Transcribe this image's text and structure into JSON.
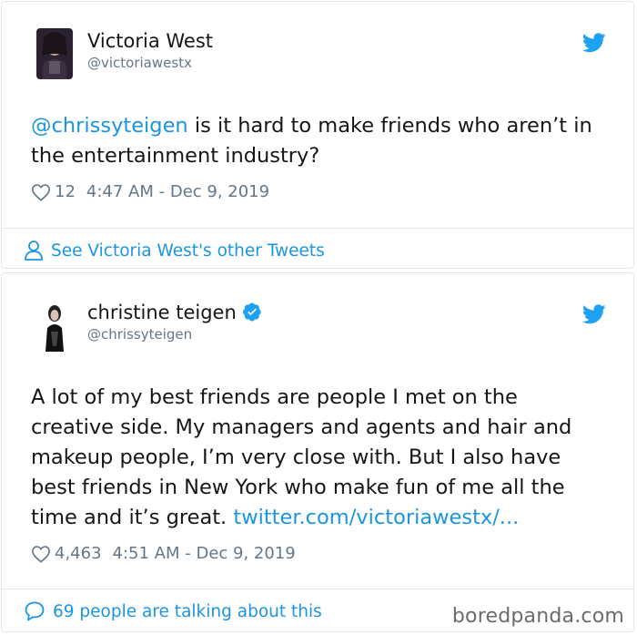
{
  "tweet1": {
    "name": "Victoria West",
    "handle": "@victoriawestx",
    "mention": "@chrissyteigen",
    "text": " is it hard to make friends who aren’t in the entertainment industry?",
    "likes": "12",
    "timestamp": "4:47 AM - Dec 9, 2019",
    "footer_link": "See Victoria West's other Tweets",
    "icons": [
      "avatar",
      "twitter-bird-icon",
      "heart-icon",
      "person-icon"
    ]
  },
  "tweet2": {
    "name": "christine teigen",
    "handle": "@chrissyteigen",
    "text": "A lot of my best friends are people I met on the creative side. My managers and agents and hair and makeup people, I’m very close with. But I also have best friends in New York who make fun of me all the time and it’s great. ",
    "link": "twitter.com/victoriawestx/...",
    "likes": "4,463",
    "timestamp": "4:51 AM - Dec 9, 2019",
    "footer_link": "69 people are talking about this",
    "icons": [
      "avatar",
      "verified-badge-icon",
      "twitter-bird-icon",
      "heart-icon",
      "speech-bubble-icon"
    ]
  },
  "watermark": "boredpanda.com",
  "colors": {
    "link": "#1b95e0",
    "muted": "#657786",
    "text": "#14171a",
    "border": "#e1e8ed"
  }
}
